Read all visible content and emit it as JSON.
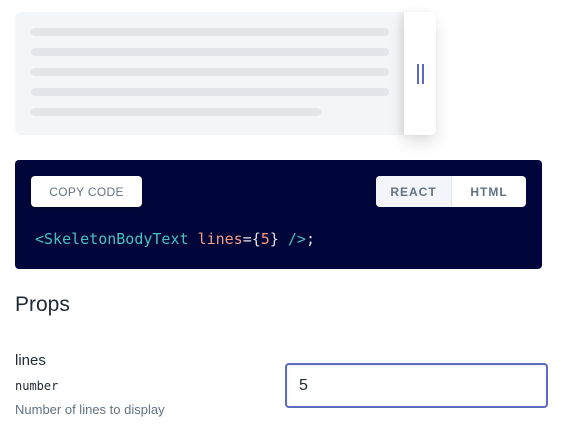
{
  "preview": {
    "line_count": 5
  },
  "code": {
    "copy_label": "COPY CODE",
    "tabs": [
      "REACT",
      "HTML"
    ],
    "active_tab": "REACT",
    "component": "<SkeletonBodyText",
    "attr": "lines",
    "eq": "={",
    "value": "5",
    "close": "}",
    "end": " />",
    "semi": ";"
  },
  "props": {
    "title": "Props",
    "items": [
      {
        "name": "lines",
        "type": "number",
        "description": "Number of lines to display",
        "value": "5"
      }
    ]
  },
  "colors": {
    "accent": "#5c6ac4",
    "code_bg": "#000639"
  }
}
